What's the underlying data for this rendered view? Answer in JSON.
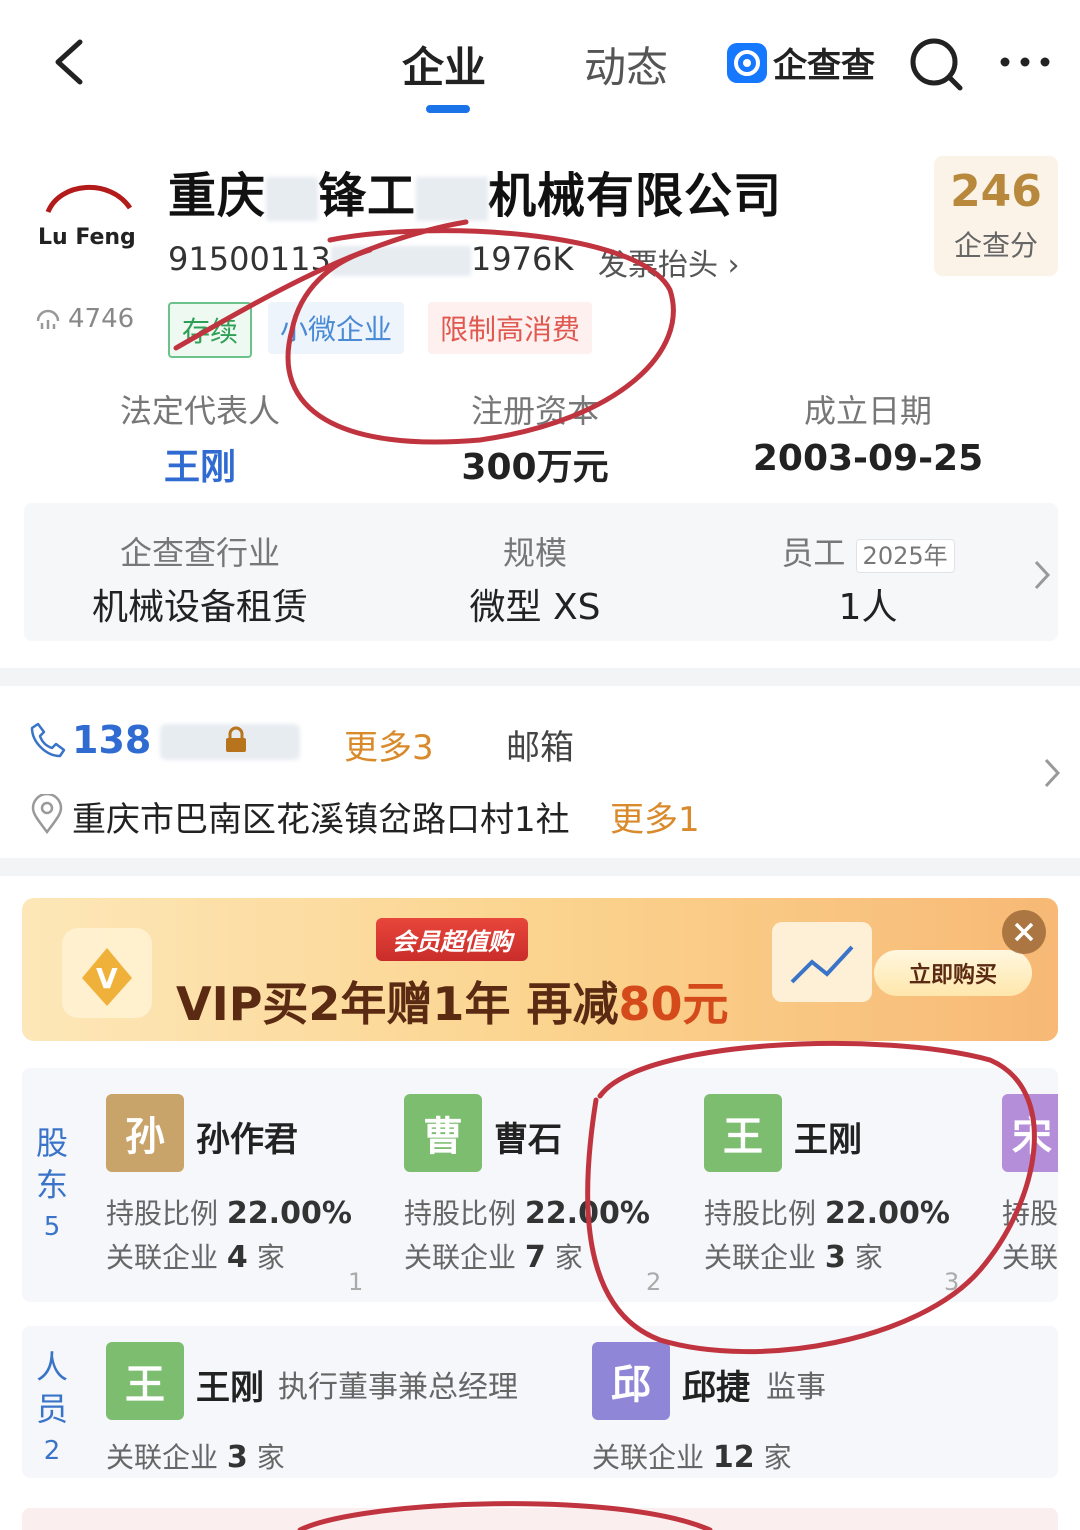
{
  "topbar": {
    "tabs": [
      "企业",
      "动态"
    ],
    "brand": "企查查"
  },
  "company": {
    "name": "重庆路锋工程机械有限公司",
    "name_visible_prefix": "重庆",
    "name_visible_mid": "锋工",
    "name_visible_suffix": "机械有限公司",
    "logo_text": "Lu Feng",
    "credit_code_prefix": "91500113",
    "credit_code_suffix": "1976K",
    "invoice_label": "发票抬头",
    "score": "246",
    "score_label": "企查分",
    "views": "4746",
    "tags": [
      "存续",
      "小微企业",
      "限制高消费"
    ]
  },
  "summary": {
    "legal_rep_label": "法定代表人",
    "legal_rep": "王刚",
    "capital_label": "注册资本",
    "capital": "300万元",
    "founded_label": "成立日期",
    "founded": "2003-09-25"
  },
  "industry": {
    "industry_label": "企查查行业",
    "industry": "机械设备租赁",
    "scale_label": "规模",
    "scale": "微型 XS",
    "staff_label": "员工",
    "staff_year": "2025年",
    "staff": "1人"
  },
  "contact": {
    "phone": "138",
    "more_phone": "更多3",
    "email_label": "邮箱",
    "address": "重庆市巴南区花溪镇岔路口村1社",
    "more_address": "更多1"
  },
  "banner": {
    "badge": "会员超值购",
    "text_main": "VIP买2年赠1年  再减",
    "text_amount": "80元",
    "button": "立即购买"
  },
  "shareholders": {
    "label_chars": [
      "股",
      "东"
    ],
    "count": "5",
    "items": [
      {
        "avatar": "孙",
        "name": "孙作君",
        "ratio_label": "持股比例",
        "ratio": "22.00%",
        "related_label": "关联企业",
        "related": "4",
        "unit": "家",
        "page": "1",
        "color": "#c9a46a"
      },
      {
        "avatar": "曹",
        "name": "曹石",
        "ratio_label": "持股比例",
        "ratio": "22.00%",
        "related_label": "关联企业",
        "related": "7",
        "unit": "家",
        "page": "2",
        "color": "#7cbd6f"
      },
      {
        "avatar": "王",
        "name": "王刚",
        "ratio_label": "持股比例",
        "ratio": "22.00%",
        "related_label": "关联企业",
        "related": "3",
        "unit": "家",
        "page": "3",
        "color": "#7cbd6f"
      }
    ],
    "partial": {
      "avatar": "宋",
      "text1": "持股",
      "text2": "关联",
      "color": "#b48ed8"
    }
  },
  "personnel": {
    "label_chars": [
      "人",
      "员"
    ],
    "count": "2",
    "items": [
      {
        "avatar": "王",
        "name": "王刚",
        "role": "执行董事兼总经理",
        "related_label": "关联企业",
        "related": "3",
        "unit": "家",
        "color": "#7cbd6f"
      },
      {
        "avatar": "邱",
        "name": "邱捷",
        "role": "监事",
        "related_label": "关联企业",
        "related": "12",
        "unit": "家",
        "color": "#8f86d8"
      }
    ]
  },
  "colors": {
    "accent": "#1a73e8",
    "annotation": "#c0343f"
  }
}
